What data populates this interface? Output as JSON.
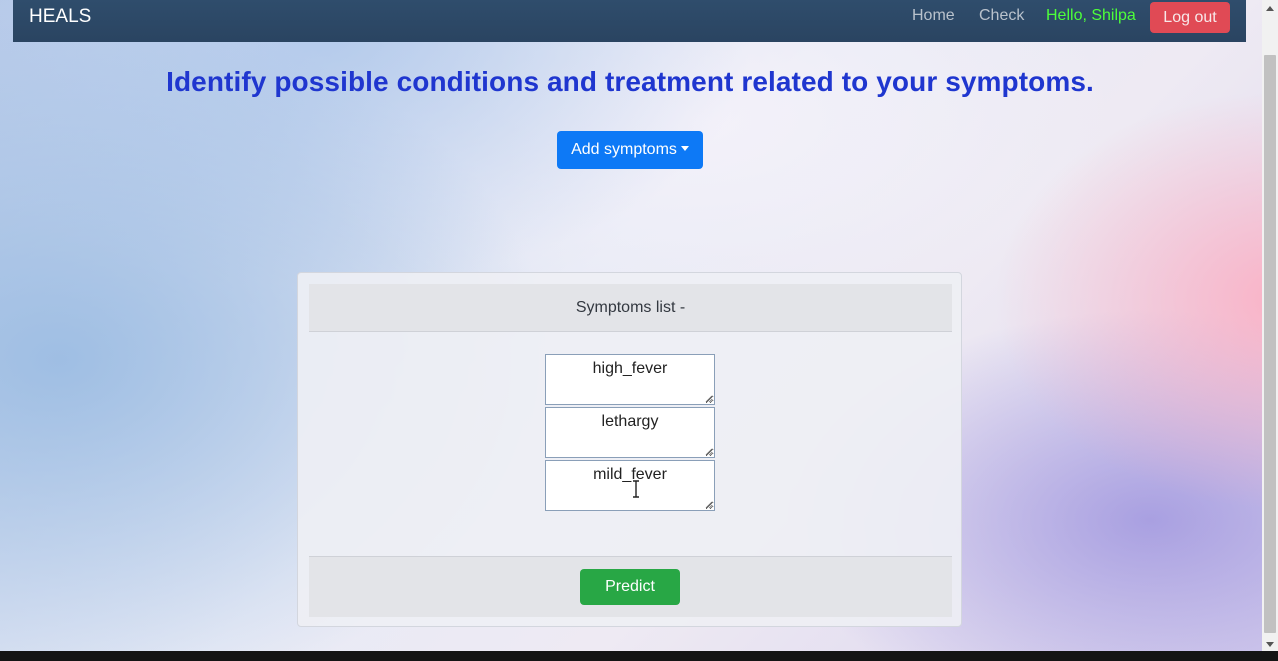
{
  "navbar": {
    "brand": "HEALS",
    "links": {
      "home": "Home",
      "check": "Check",
      "greeting": "Hello, Shilpa"
    },
    "logout_label": "Log out"
  },
  "main": {
    "headline": "Identify possible conditions and treatment related to your symptoms.",
    "add_symptoms_label": "Add symptoms"
  },
  "card": {
    "header": "Symptoms list -",
    "symptoms": [
      "high_fever",
      "lethargy",
      "mild_fever"
    ],
    "predict_label": "Predict"
  },
  "colors": {
    "navbar": "#2f4d6c",
    "greeting": "#4dff3a",
    "logout": "#e04a55",
    "headline": "#1f36cf",
    "primary": "#0d79f6",
    "success": "#28a745"
  },
  "icons": {
    "dropdown": "caret-down-icon",
    "cursor": "text-cursor-icon",
    "resize": "resize-grip-icon"
  }
}
